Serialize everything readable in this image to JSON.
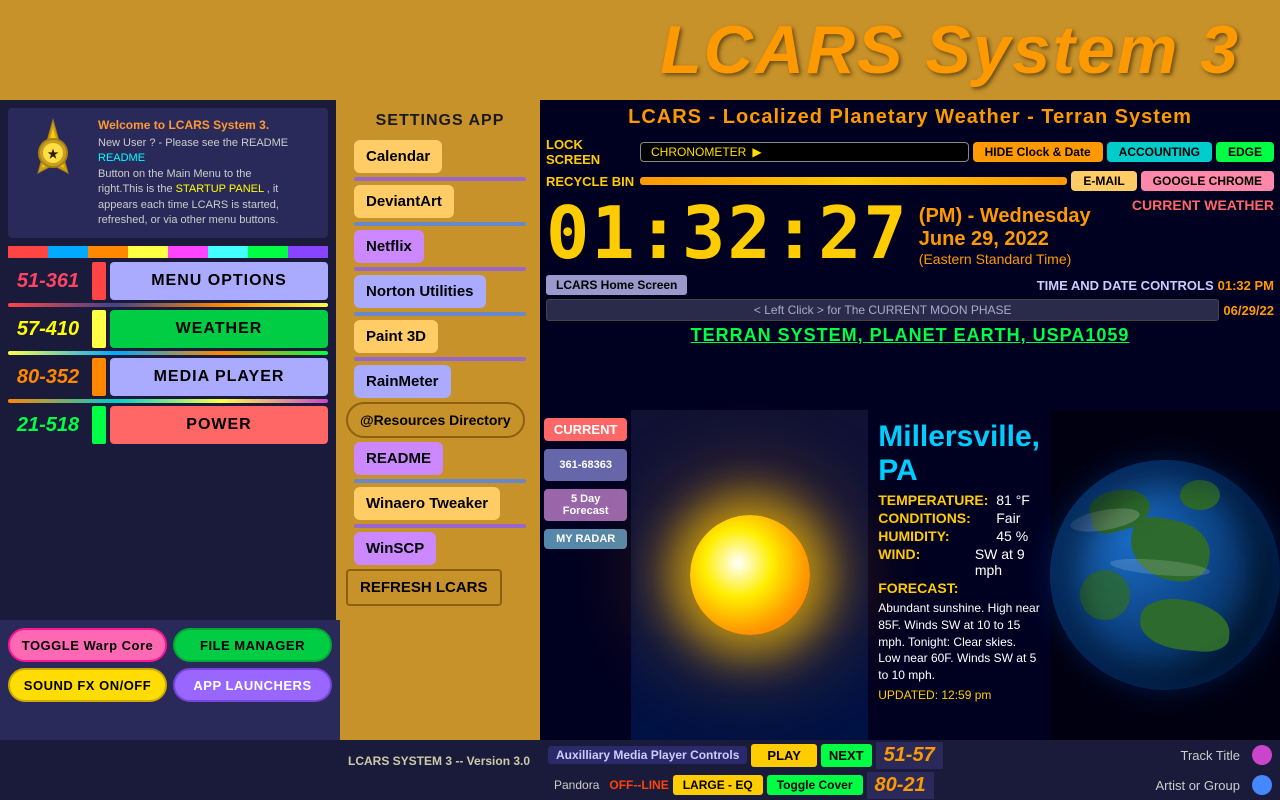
{
  "header": {
    "title": "LCARS  System 3",
    "bg_color": "#c8922a"
  },
  "weather_subtitle": "LCARS - Localized Planetary Weather - Terran System",
  "left_panel": {
    "welcome": {
      "title": "Welcome to LCARS  System 3.",
      "body_line1": "New User ? - Please see the README",
      "body_link": "README",
      "body_line2": "Button on the Main Menu to the",
      "body_line3": "right.This is the",
      "body_highlight": "STARTUP PANEL",
      "body_line4": ", it",
      "body_line5": "appears each time LCARS is started,",
      "body_line6": "refreshed, or via other menu buttons."
    },
    "color_bars": [
      "#ff4444",
      "#44ff44",
      "#4444ff",
      "#ffff44",
      "#ff44ff",
      "#44ffff",
      "#ff8800",
      "#8800ff"
    ],
    "nav_items": [
      {
        "number": "51-361",
        "number_color": "#ff4466",
        "strip_color": "#ff4444",
        "btn_label": "MENU OPTIONS",
        "btn_color": "#aaaaff"
      },
      {
        "number": "57-410",
        "number_color": "#ffff00",
        "strip_color": "#ffff44",
        "btn_label": "WEATHER",
        "btn_color": "#00cc44"
      },
      {
        "number": "80-352",
        "number_color": "#ff8800",
        "strip_color": "#ff8800",
        "btn_label": "MEDIA  PLAYER",
        "btn_color": "#aaaaff"
      },
      {
        "number": "21-518",
        "number_color": "#00ff44",
        "strip_color": "#00ff44",
        "btn_label": "POWER",
        "btn_color": "#ff6666"
      }
    ],
    "bottom_buttons": [
      {
        "label": "TOGGLE Warp Core",
        "class": "btn-pink"
      },
      {
        "label": "FILE  MANAGER",
        "class": "btn-green"
      },
      {
        "label": "SOUND FX  ON/OFF",
        "class": "btn-yellow"
      },
      {
        "label": "APP  LAUNCHERS",
        "class": "btn-lavender"
      }
    ]
  },
  "middle_panel": {
    "settings_label": "SETTINGS  APP",
    "items": [
      {
        "label": "Calendar",
        "color": "#ffcc66"
      },
      {
        "label": "DeviantArt",
        "color": "#ffcc66"
      },
      {
        "label": "Netflix",
        "color": "#cc88ff"
      },
      {
        "label": "Norton Utilities",
        "color": "#aaaaff"
      },
      {
        "label": "Paint 3D",
        "color": "#ffcc66"
      },
      {
        "label": "RainMeter",
        "color": "#aaaaff"
      },
      {
        "label": "@Resources Directory",
        "color": "#c8922a"
      },
      {
        "label": "README",
        "color": "#cc88ff"
      },
      {
        "label": "Winaero Tweaker",
        "color": "#ffcc66"
      },
      {
        "label": "WinSCP",
        "color": "#cc88ff"
      },
      {
        "label": "REFRESH  LCARS",
        "color": "#c8922a"
      }
    ]
  },
  "clock": {
    "time": "01:32:27",
    "ampm": "(PM) - Wednesday",
    "date": "June 29, 2022",
    "timezone": "(Eastern Standard Time)"
  },
  "controls": {
    "lock_screen_label": "LOCK  SCREEN",
    "recycle_bin_label": "RECYCLE  BIN",
    "chronometer_label": "CHRONOMETER",
    "hide_clock_btn": "HIDE Clock & Date",
    "accounting_btn": "ACCOUNTING",
    "edge_btn": "EDGE",
    "email_btn": "E-MAIL",
    "google_chrome_btn": "GOOGLE CHROME",
    "current_weather_label": "CURRENT  WEATHER",
    "home_screen_btn": "LCARS  Home Screen",
    "time_date_ctrl_label": "TIME AND DATE CONTROLS",
    "time_display": "01:32 PM",
    "moon_phase_btn": "< Left Click >  for The  CURRENT  MOON PHASE",
    "moon_date": "06/29/22",
    "terran_label": "TERRAN  SYSTEM, PLANET  EARTH, USPA1059",
    "segment_number": "361-68363"
  },
  "weather": {
    "city": "Millersville, PA",
    "current_label": "CURRENT",
    "forecast_label": "5 Day Forecast",
    "radar_label": "MY RADAR",
    "temperature_key": "TEMPERATURE:",
    "temperature_val": "81 °F",
    "conditions_key": "CONDITIONS:",
    "conditions_val": "Fair",
    "humidity_key": "HUMIDITY:",
    "humidity_val": "45 %",
    "wind_key": "WIND:",
    "wind_val": "SW at 9 mph",
    "forecast_key": "FORECAST:",
    "forecast_val": "Abundant sunshine. High near 85F. Winds SW at 10 to 15 mph. Tonight:  Clear skies. Low near 60F. Winds SW at 5 to 10 mph.",
    "updated": "UPDATED:  12:59 pm"
  },
  "bottom_bar": {
    "media_label": "Auxilliary Media Player Controls",
    "play_btn": "PLAY",
    "next_btn": "NEXT",
    "track_nums_top": "51-57",
    "track_title_label": "Track  Title",
    "version_label": "LCARS  SYSTEM 3 -- Version 3.0",
    "pandora_label": "Pandora",
    "pandora_status": "OFF--LINE",
    "large_eq_btn": "LARGE - EQ",
    "toggle_cover_btn": "Toggle Cover",
    "track_nums_bottom": "80-21",
    "artist_label": "Artist  or  Group"
  }
}
